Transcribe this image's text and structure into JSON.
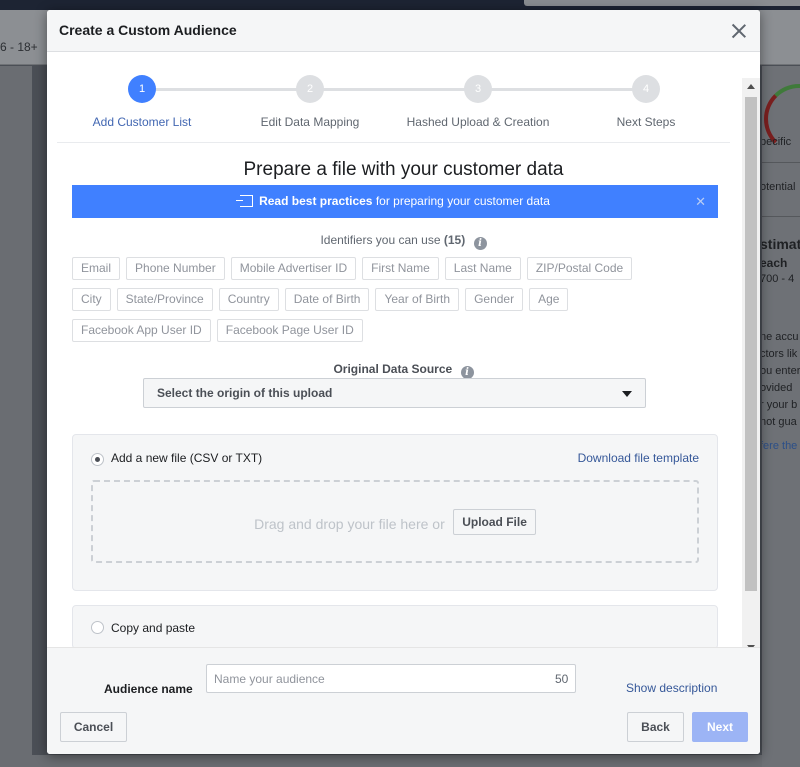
{
  "background": {
    "age_text": "6 - 18+",
    "right_panel": [
      "pecific",
      "otential",
      "stimat",
      "each",
      "700 - 4",
      "ne accu",
      "ctors lik",
      "ou enter",
      "ovided",
      "r your b",
      "not gua",
      "fere the"
    ]
  },
  "modal": {
    "title": "Create a Custom Audience",
    "steps": [
      {
        "number": "1",
        "label": "Add Customer List",
        "state": "active"
      },
      {
        "number": "2",
        "label": "Edit Data Mapping",
        "state": "inactive"
      },
      {
        "number": "3",
        "label": "Hashed Upload & Creation",
        "state": "inactive"
      },
      {
        "number": "4",
        "label": "Next Steps",
        "state": "inactive"
      }
    ],
    "section_title": "Prepare a file with your customer data",
    "banner": {
      "bold": "Read best practices",
      "rest": " for preparing your customer data"
    },
    "identifiers": {
      "title": "Identifiers you can use",
      "count": "(15)",
      "chips": [
        "Email",
        "Phone Number",
        "Mobile Advertiser ID",
        "First Name",
        "Last Name",
        "ZIP/Postal Code",
        "City",
        "State/Province",
        "Country",
        "Date of Birth",
        "Year of Birth",
        "Gender",
        "Age",
        "Facebook App User ID",
        "Facebook Page User ID"
      ]
    },
    "source": {
      "title": "Original Data Source",
      "select_value": "Select the origin of this upload"
    },
    "upload": {
      "option_label": "Add a new file (CSV or TXT)",
      "template_link": "Download file template",
      "drop_text": "Drag and drop your file here or",
      "upload_button": "Upload File"
    },
    "paste": {
      "option_label": "Copy and paste"
    },
    "footer": {
      "audience_label": "Audience name",
      "audience_placeholder": "Name your audience",
      "char_limit": "50",
      "show_description": "Show description",
      "cancel": "Cancel",
      "back": "Back",
      "next": "Next"
    }
  },
  "colors": {
    "accent": "#4080ff",
    "link": "#365899",
    "disabled_primary": "#9cb4f5"
  }
}
